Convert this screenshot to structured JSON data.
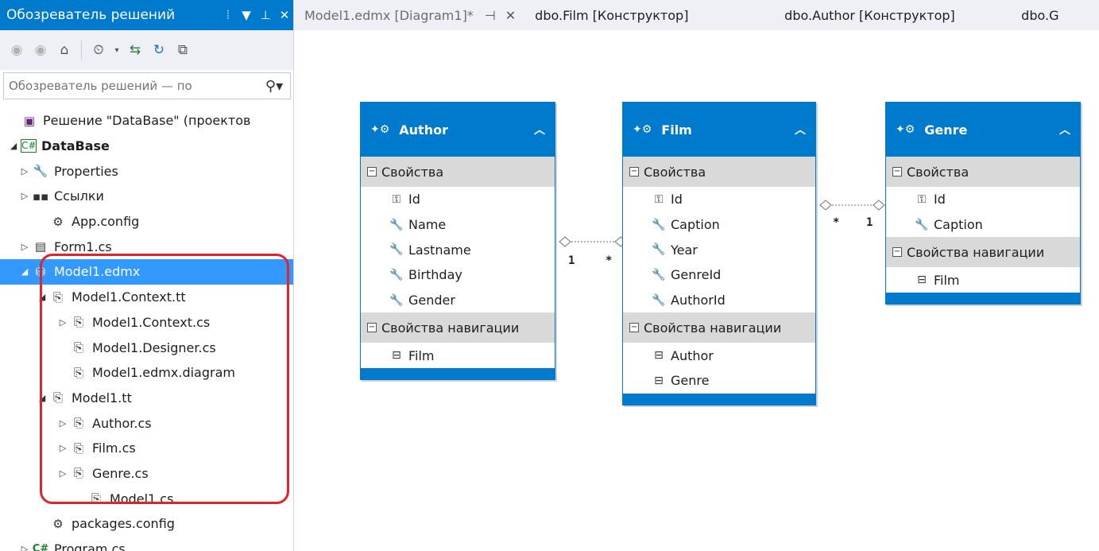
{
  "solution_explorer": {
    "title": "Обозреватель решений",
    "search_placeholder": "Обозреватель решений — по",
    "tree": [
      {
        "label": "Решение \"DataBase\" (проектов",
        "icon": "solution-icon",
        "glyph": "▣",
        "cls": "sln",
        "indent": 0,
        "exp": ""
      },
      {
        "label": "DataBase",
        "icon": "csharp-project-icon",
        "glyph": "C#",
        "cls": "csproj",
        "indent": 0,
        "exp": "◢",
        "bold": true
      },
      {
        "label": "Properties",
        "icon": "wrench-icon",
        "glyph": "🔧",
        "cls": "wrench",
        "indent": 1,
        "exp": "▷"
      },
      {
        "label": "Ссылки",
        "icon": "references-icon",
        "glyph": "▪▪",
        "cls": "refs",
        "indent": 1,
        "exp": "▷"
      },
      {
        "label": "App.config",
        "icon": "config-file-icon",
        "glyph": "⚙",
        "cls": "config",
        "indent": 2,
        "exp": ""
      },
      {
        "label": "Form1.cs",
        "icon": "form-icon",
        "glyph": "▤",
        "cls": "form",
        "indent": 1,
        "exp": "▷"
      },
      {
        "label": "Model1.edmx",
        "icon": "edmx-icon",
        "glyph": "⛁",
        "cls": "edmx",
        "indent": 1,
        "exp": "◢",
        "selected": true
      },
      {
        "label": "Model1.Context.tt",
        "icon": "template-file-icon",
        "glyph": "⎘",
        "cls": "tt",
        "indent": 2,
        "exp": "◢"
      },
      {
        "label": "Model1.Context.cs",
        "icon": "template-file-icon",
        "glyph": "⎘",
        "cls": "tt",
        "indent": 3,
        "exp": "▷"
      },
      {
        "label": "Model1.Designer.cs",
        "icon": "template-file-icon",
        "glyph": "⎘",
        "cls": "tt",
        "indent": 3,
        "exp": ""
      },
      {
        "label": "Model1.edmx.diagram",
        "icon": "template-file-icon",
        "glyph": "⎘",
        "cls": "tt",
        "indent": 3,
        "exp": ""
      },
      {
        "label": "Model1.tt",
        "icon": "template-file-icon",
        "glyph": "⎘",
        "cls": "tt",
        "indent": 2,
        "exp": "◢"
      },
      {
        "label": "Author.cs",
        "icon": "template-file-icon",
        "glyph": "⎘",
        "cls": "tt",
        "indent": 3,
        "exp": "▷"
      },
      {
        "label": "Film.cs",
        "icon": "template-file-icon",
        "glyph": "⎘",
        "cls": "tt",
        "indent": 3,
        "exp": "▷"
      },
      {
        "label": "Genre.cs",
        "icon": "template-file-icon",
        "glyph": "⎘",
        "cls": "tt",
        "indent": 3,
        "exp": "▷"
      },
      {
        "label": "Model1.cs",
        "icon": "template-file-icon",
        "glyph": "⎘",
        "cls": "tt",
        "indent": 4,
        "exp": ""
      },
      {
        "label": "packages.config",
        "icon": "config-file-icon",
        "glyph": "⚙",
        "cls": "config",
        "indent": 2,
        "exp": ""
      },
      {
        "label": "Program.cs",
        "icon": "csharp-file-icon",
        "glyph": "C#",
        "cls": "cs",
        "indent": 1,
        "exp": "▷"
      }
    ]
  },
  "tabs": [
    {
      "label": "Model1.edmx [Diagram1]*",
      "active": true
    },
    {
      "label": "dbo.Film [Конструктор]",
      "active": false
    },
    {
      "label": "dbo.Author [Конструктор]",
      "active": false
    },
    {
      "label": "dbo.G",
      "active": false
    }
  ],
  "designer": {
    "properties_section": "Свойства",
    "navigation_section": "Свойства навигации",
    "entities": [
      {
        "name": "Author",
        "properties": [
          {
            "name": "Id",
            "icon": "key-icon"
          },
          {
            "name": "Name",
            "icon": "property-icon"
          },
          {
            "name": "Lastname",
            "icon": "property-icon"
          },
          {
            "name": "Birthday",
            "icon": "property-icon"
          },
          {
            "name": "Gender",
            "icon": "property-icon"
          }
        ],
        "navigation": [
          {
            "name": "Film"
          }
        ]
      },
      {
        "name": "Film",
        "properties": [
          {
            "name": "Id",
            "icon": "key-icon"
          },
          {
            "name": "Caption",
            "icon": "property-icon"
          },
          {
            "name": "Year",
            "icon": "property-icon"
          },
          {
            "name": "GenreId",
            "icon": "property-icon"
          },
          {
            "name": "AuthorId",
            "icon": "property-icon"
          }
        ],
        "navigation": [
          {
            "name": "Author"
          },
          {
            "name": "Genre"
          }
        ]
      },
      {
        "name": "Genre",
        "properties": [
          {
            "name": "Id",
            "icon": "key-icon"
          },
          {
            "name": "Caption",
            "icon": "property-icon"
          }
        ],
        "navigation": [
          {
            "name": "Film"
          }
        ]
      }
    ],
    "associations": [
      {
        "from": "Author",
        "to": "Film",
        "from_mult": "1",
        "to_mult": "*"
      },
      {
        "from": "Film",
        "to": "Genre",
        "from_mult": "*",
        "to_mult": "1"
      }
    ]
  },
  "colors": {
    "accent": "#007acc",
    "selection": "#3399ff",
    "highlight_ring": "#e0242e"
  }
}
